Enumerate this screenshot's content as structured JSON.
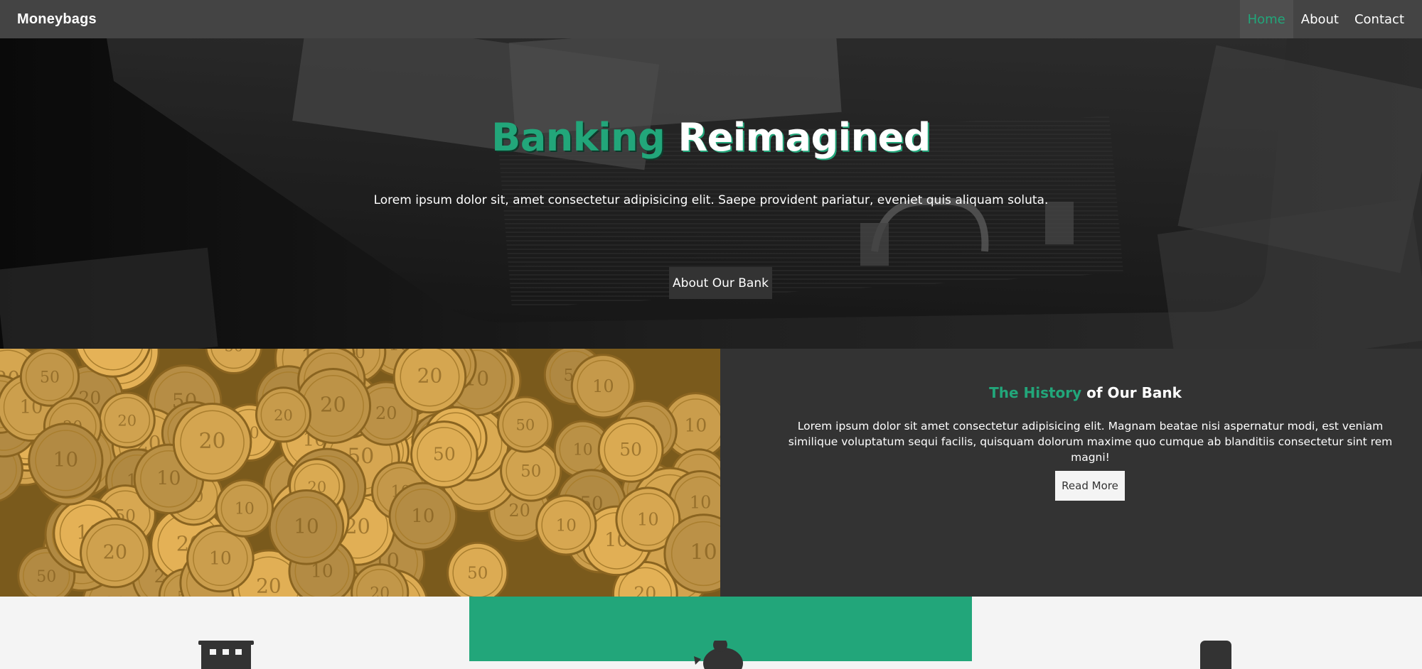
{
  "nav": {
    "brand": "Moneybags",
    "links": [
      {
        "label": "Home",
        "active": true
      },
      {
        "label": "About",
        "active": false
      },
      {
        "label": "Contact",
        "active": false
      }
    ]
  },
  "hero": {
    "title_accent": "Banking",
    "title_rest": "Reimagined",
    "text": "Lorem ipsum dolor sit, amet consectetur adipisicing elit. Saepe provident pariatur, eveniet quis aliquam soluta.",
    "button_label": "About Our Bank"
  },
  "history": {
    "title_accent": "The History",
    "title_rest": "of Our Bank",
    "text": "Lorem ipsum dolor sit amet consectetur adipisicing elit. Magnam beatae nisi aspernatur modi, est veniam similique voluptatum sequi facilis, quisquam dolorum maxime quo cumque ab blanditiis consectetur sint rem magni!",
    "button_label": "Read More"
  },
  "features": {
    "icons": [
      "building-icon",
      "piggy-bank-icon",
      "mobile-icon"
    ]
  },
  "colors": {
    "accent": "#22a67a",
    "dark": "#333333",
    "nav": "#444444",
    "light": "#f4f4f4"
  }
}
